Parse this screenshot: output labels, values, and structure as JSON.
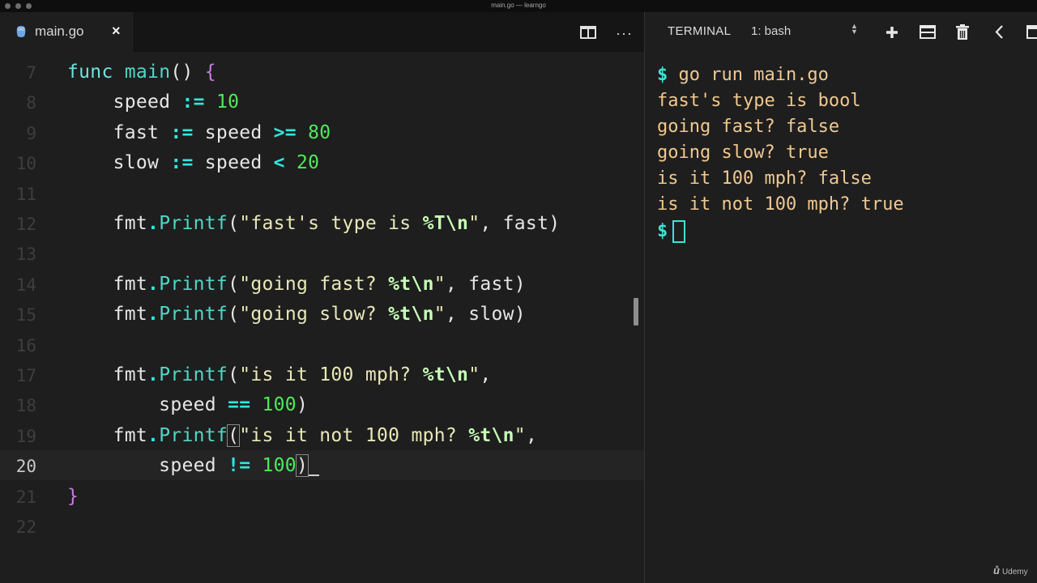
{
  "window": {
    "title": "main.go — learngo"
  },
  "editor_tab": {
    "label": "main.go",
    "close_glyph": "×",
    "icon": "go-gopher-icon"
  },
  "toolbar": {
    "split_icon": "split-editor-icon",
    "more_label": "···"
  },
  "code_lines": [
    {
      "num": "7",
      "tokens": [
        {
          "t": "func ",
          "c": "kw"
        },
        {
          "t": "main",
          "c": "fn"
        },
        {
          "t": "() ",
          "c": ""
        },
        {
          "t": "{",
          "c": "brace"
        }
      ]
    },
    {
      "num": "8",
      "tokens": [
        {
          "t": "    speed ",
          "c": ""
        },
        {
          "t": ":=",
          "c": "op"
        },
        {
          "t": " ",
          "c": ""
        },
        {
          "t": "10",
          "c": "num"
        }
      ]
    },
    {
      "num": "9",
      "tokens": [
        {
          "t": "    fast ",
          "c": ""
        },
        {
          "t": ":=",
          "c": "op"
        },
        {
          "t": " speed ",
          "c": ""
        },
        {
          "t": ">=",
          "c": "op"
        },
        {
          "t": " ",
          "c": ""
        },
        {
          "t": "80",
          "c": "num"
        }
      ]
    },
    {
      "num": "10",
      "tokens": [
        {
          "t": "    slow ",
          "c": ""
        },
        {
          "t": ":=",
          "c": "op"
        },
        {
          "t": " speed ",
          "c": ""
        },
        {
          "t": "<",
          "c": "op"
        },
        {
          "t": " ",
          "c": ""
        },
        {
          "t": "20",
          "c": "num"
        }
      ]
    },
    {
      "num": "11",
      "tokens": []
    },
    {
      "num": "12",
      "tokens": [
        {
          "t": "    fmt",
          "c": ""
        },
        {
          "t": ".",
          "c": "op"
        },
        {
          "t": "Printf",
          "c": "fn"
        },
        {
          "t": "(",
          "c": ""
        },
        {
          "t": "\"fast's type is ",
          "c": "str"
        },
        {
          "t": "%T\\n",
          "c": "esc"
        },
        {
          "t": "\"",
          "c": "str"
        },
        {
          "t": ", fast)",
          "c": ""
        }
      ]
    },
    {
      "num": "13",
      "tokens": []
    },
    {
      "num": "14",
      "tokens": [
        {
          "t": "    fmt",
          "c": ""
        },
        {
          "t": ".",
          "c": "op"
        },
        {
          "t": "Printf",
          "c": "fn"
        },
        {
          "t": "(",
          "c": ""
        },
        {
          "t": "\"going fast? ",
          "c": "str"
        },
        {
          "t": "%t\\n",
          "c": "esc"
        },
        {
          "t": "\"",
          "c": "str"
        },
        {
          "t": ", fast)",
          "c": ""
        }
      ]
    },
    {
      "num": "15",
      "tokens": [
        {
          "t": "    fmt",
          "c": ""
        },
        {
          "t": ".",
          "c": "op"
        },
        {
          "t": "Printf",
          "c": "fn"
        },
        {
          "t": "(",
          "c": ""
        },
        {
          "t": "\"going slow? ",
          "c": "str"
        },
        {
          "t": "%t\\n",
          "c": "esc"
        },
        {
          "t": "\"",
          "c": "str"
        },
        {
          "t": ", slow)",
          "c": ""
        }
      ]
    },
    {
      "num": "16",
      "tokens": []
    },
    {
      "num": "17",
      "tokens": [
        {
          "t": "    fmt",
          "c": ""
        },
        {
          "t": ".",
          "c": "op"
        },
        {
          "t": "Printf",
          "c": "fn"
        },
        {
          "t": "(",
          "c": ""
        },
        {
          "t": "\"is it 100 mph? ",
          "c": "str"
        },
        {
          "t": "%t\\n",
          "c": "esc"
        },
        {
          "t": "\"",
          "c": "str"
        },
        {
          "t": ",",
          "c": ""
        }
      ]
    },
    {
      "num": "18",
      "tokens": [
        {
          "t": "        speed ",
          "c": ""
        },
        {
          "t": "==",
          "c": "op"
        },
        {
          "t": " ",
          "c": ""
        },
        {
          "t": "100",
          "c": "num"
        },
        {
          "t": ")",
          "c": ""
        }
      ]
    },
    {
      "num": "19",
      "tokens": [
        {
          "t": "    fmt",
          "c": ""
        },
        {
          "t": ".",
          "c": "op"
        },
        {
          "t": "Printf",
          "c": "fn"
        },
        {
          "t": "(",
          "c": "bracket-match"
        },
        {
          "t": "\"is it not 100 mph? ",
          "c": "str"
        },
        {
          "t": "%t\\n",
          "c": "esc"
        },
        {
          "t": "\"",
          "c": "str"
        },
        {
          "t": ",",
          "c": ""
        }
      ]
    },
    {
      "num": "20",
      "current": true,
      "cursor": true,
      "tokens": [
        {
          "t": "        speed ",
          "c": ""
        },
        {
          "t": "!=",
          "c": "op"
        },
        {
          "t": " ",
          "c": ""
        },
        {
          "t": "100",
          "c": "num"
        },
        {
          "t": ")",
          "c": "bracket-match"
        }
      ]
    },
    {
      "num": "21",
      "tokens": [
        {
          "t": "}",
          "c": "brace"
        }
      ]
    },
    {
      "num": "22",
      "tokens": []
    }
  ],
  "terminal_header": {
    "title": "TERMINAL",
    "shell_select": "1: bash",
    "icons": [
      "plus-icon",
      "split-terminal-icon",
      "trash-icon",
      "chevron-left-icon",
      "maximize-icon"
    ]
  },
  "terminal_lines": [
    {
      "prompt": "$",
      "text": " go run main.go"
    },
    {
      "prompt": "",
      "text": "fast's type is bool"
    },
    {
      "prompt": "",
      "text": "going fast? false"
    },
    {
      "prompt": "",
      "text": "going slow? true"
    },
    {
      "prompt": "",
      "text": "is it 100 mph? false"
    },
    {
      "prompt": "",
      "text": "is it not 100 mph? true"
    },
    {
      "prompt": "$",
      "text": "",
      "cursor": true
    }
  ],
  "watermark": {
    "mark": "ů",
    "label": "Udemy"
  }
}
